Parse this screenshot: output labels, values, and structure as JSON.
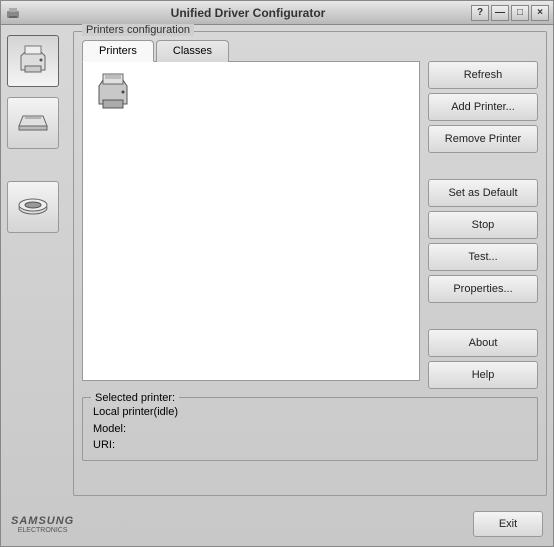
{
  "window": {
    "title": "Unified Driver Configurator"
  },
  "groupbox": {
    "title": "Printers configuration"
  },
  "tabs": {
    "printers": "Printers",
    "classes": "Classes"
  },
  "buttons": {
    "refresh": "Refresh",
    "add": "Add Printer...",
    "remove": "Remove Printer",
    "setdefault": "Set as Default",
    "stop": "Stop",
    "test": "Test...",
    "properties": "Properties...",
    "about": "About",
    "help": "Help",
    "exit": "Exit"
  },
  "selected": {
    "title": "Selected printer:",
    "line1": "Local printer(idle)",
    "line2": "Model:",
    "line3": "URI:"
  },
  "brand": {
    "name": "SAMSUNG",
    "sub": "ELECTRONICS"
  }
}
